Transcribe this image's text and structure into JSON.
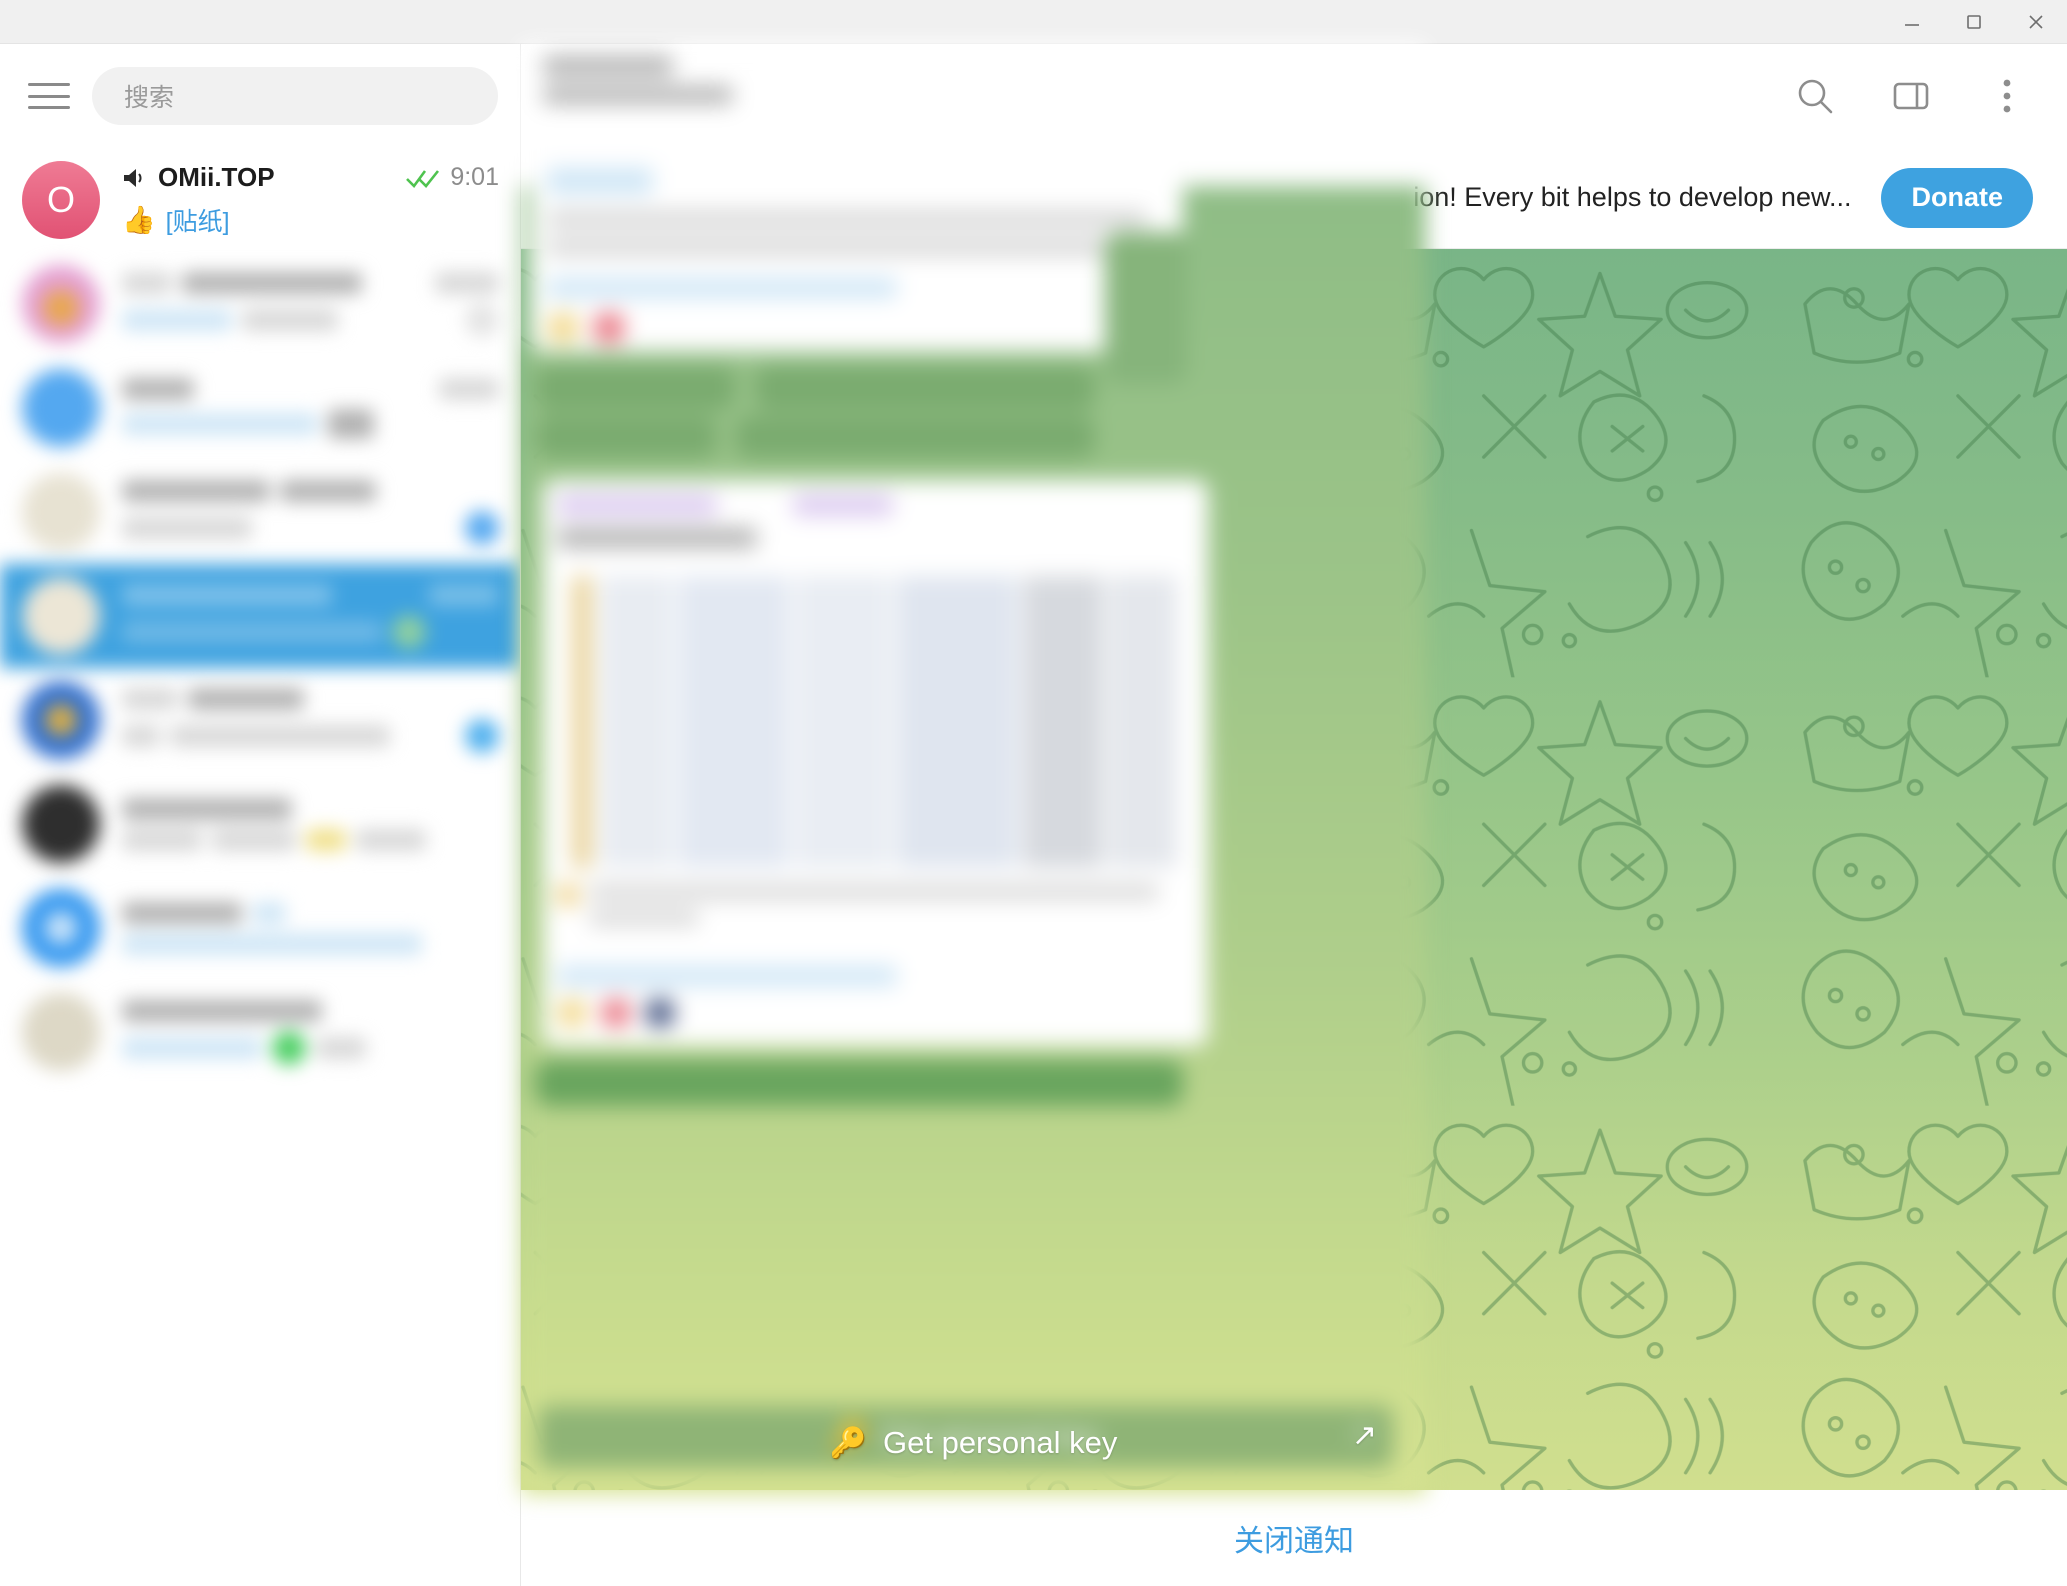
{
  "window": {
    "controls": [
      {
        "name": "minimize",
        "glyph": "minimize-icon"
      },
      {
        "name": "maximize",
        "glyph": "maximize-icon"
      },
      {
        "name": "close",
        "glyph": "close-icon"
      }
    ]
  },
  "sidebar": {
    "menu_icon": "hamburger-menu-icon",
    "search": {
      "placeholder": "搜索",
      "value": ""
    },
    "chats": [
      {
        "avatar_letter": "O",
        "avatar_color": "#e8617f",
        "name": "OMii.TOP",
        "is_channel": true,
        "time": "9:01",
        "read_status": "double-check-icon",
        "preview_emoji": "👍",
        "preview": "[贴纸]",
        "blurred": false,
        "selected": false
      },
      {
        "avatar_color": "#e4a0d2",
        "blurred": true,
        "selected": false,
        "name": "",
        "preview": "",
        "time": ""
      },
      {
        "avatar_color": "#54a8f0",
        "blurred": true,
        "selected": false,
        "name": "",
        "preview": "",
        "time": ""
      },
      {
        "avatar_color": "#e8e2d0",
        "blurred": true,
        "selected": false,
        "name": "",
        "preview": "",
        "time": ""
      },
      {
        "avatar_color": "#d8d4c6",
        "blurred": true,
        "selected": true,
        "name": "",
        "preview": "",
        "time": ""
      },
      {
        "avatar_color": "#3f7fd0",
        "blurred": true,
        "selected": false,
        "name": "",
        "preview": "",
        "time": ""
      },
      {
        "avatar_color": "#3a3a3a",
        "blurred": true,
        "selected": false,
        "name": "",
        "preview": "",
        "time": ""
      },
      {
        "avatar_color": "#3ea2f0",
        "blurred": true,
        "selected": false,
        "name": "",
        "preview": "",
        "time": ""
      },
      {
        "avatar_color": "#ddd8c8",
        "blurred": true,
        "selected": false,
        "name": "",
        "preview": "",
        "time": ""
      }
    ]
  },
  "chat_header": {
    "icons": [
      {
        "name": "search-icon"
      },
      {
        "name": "sidebar-toggle-icon"
      },
      {
        "name": "more-vertical-icon"
      }
    ]
  },
  "donate_banner": {
    "text": "ion! Every bit helps to develop new...",
    "button_label": "Donate",
    "accent_color": "#3ea2e0"
  },
  "wallpaper": {
    "type": "telegram-doodle-pattern",
    "gradient_top": "#79b587",
    "gradient_bottom": "#d3e08e"
  },
  "overlay_panel": {
    "state": "blurred",
    "key_button": {
      "emoji": "🔑",
      "label": "Get personal key",
      "external_link_icon": "arrow-up-right-icon"
    }
  },
  "forward_button": {
    "icon": "forward-arrow-icon"
  },
  "bottom_bar": {
    "close_notice_label": "关闭通知",
    "color": "#3d9ce0"
  }
}
